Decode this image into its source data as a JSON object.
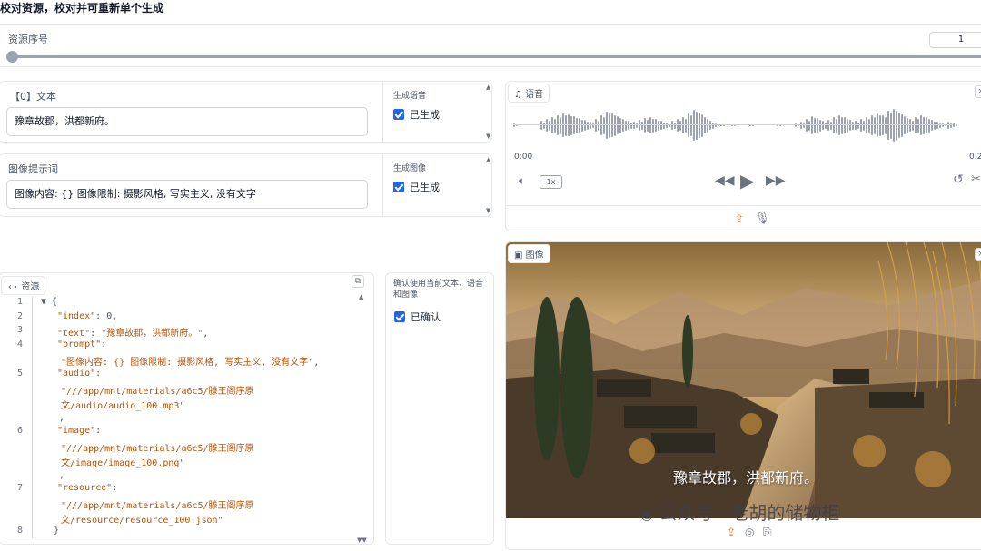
{
  "header": {
    "title": "校对资源，校对并可重新单个生成"
  },
  "index_slider": {
    "label": "资源序号",
    "value": "1",
    "fraction": 0.0
  },
  "text_panel": {
    "label": "【0】文本",
    "value": "豫章故郡，洪都新府。",
    "status_label": "生成语音",
    "status_check": "已生成"
  },
  "image_prompt_panel": {
    "label": "图像提示词",
    "value": "图像内容: {} 图像限制: 摄影风格, 写实主义, 没有文字",
    "status_label": "生成图像",
    "status_check": "已生成"
  },
  "resource_panel": {
    "label": "资源",
    "line_numbers": [
      "1",
      "2",
      "3",
      "4",
      "5",
      "6",
      "7",
      "8"
    ],
    "json_lines": [
      {
        "ln": "1",
        "parts": [
          [
            "punc",
            "▼ {"
          ]
        ]
      },
      {
        "ln": "2",
        "parts": [
          [
            "key",
            "\"index\""
          ],
          [
            "punc",
            ": 0,"
          ]
        ]
      },
      {
        "ln": "3",
        "parts": [
          [
            "key",
            "\"text\""
          ],
          [
            "punc",
            ": "
          ],
          [
            "str",
            "\"豫章故郡，洪都新府。\""
          ],
          [
            "punc",
            ","
          ]
        ]
      },
      {
        "ln": "4",
        "parts": [
          [
            "key",
            "\"prompt\""
          ],
          [
            "punc",
            ":"
          ]
        ]
      },
      {
        "ln": "",
        "parts": [
          [
            "str",
            "\"图像内容: {} 图像限制: 摄影风格, 写实主义, 没有文字\""
          ],
          [
            "punc",
            ","
          ]
        ]
      },
      {
        "ln": "5",
        "parts": [
          [
            "key",
            "\"audio\""
          ],
          [
            "punc",
            ":"
          ]
        ]
      },
      {
        "ln": "",
        "parts": [
          [
            "str",
            "\"///app/mnt/materials/a6c5/滕王阁序原"
          ]
        ]
      },
      {
        "ln": "",
        "parts": [
          [
            "str",
            "文/audio/audio_100.mp3\""
          ]
        ]
      },
      {
        "ln": "",
        "parts": [
          [
            "punc",
            ","
          ]
        ]
      },
      {
        "ln": "6",
        "parts": [
          [
            "key",
            "\"image\""
          ],
          [
            "punc",
            ":"
          ]
        ]
      },
      {
        "ln": "",
        "parts": [
          [
            "str",
            "\"///app/mnt/materials/a6c5/滕王阁序原"
          ]
        ]
      },
      {
        "ln": "",
        "parts": [
          [
            "str",
            "文/image/image_100.png\""
          ]
        ]
      },
      {
        "ln": "",
        "parts": [
          [
            "punc",
            ","
          ]
        ]
      },
      {
        "ln": "7",
        "parts": [
          [
            "key",
            "\"resource\""
          ],
          [
            "punc",
            ":"
          ]
        ]
      },
      {
        "ln": "",
        "parts": [
          [
            "str",
            "\"///app/mnt/materials/a6c5/滕王阁序原"
          ]
        ]
      },
      {
        "ln": "",
        "parts": [
          [
            "str",
            "文/resource/resource_100.json\""
          ]
        ]
      },
      {
        "ln": "8",
        "parts": [
          [
            "punc",
            "}"
          ]
        ]
      }
    ]
  },
  "confirm_panel": {
    "label": "确认使用当前文本、语音和图像",
    "check": "已确认"
  },
  "audio_panel": {
    "label": "语音",
    "time_start": "0:00",
    "time_end": "0:2",
    "speed": "1x"
  },
  "image_panel": {
    "label": "图像",
    "caption": "豫章故郡，洪都新府。",
    "watermark": "公众号 · 老胡的储物柜"
  },
  "colors": {
    "accent": "#2563eb",
    "border": "#e5e7eb",
    "track": "#9ca3af"
  }
}
